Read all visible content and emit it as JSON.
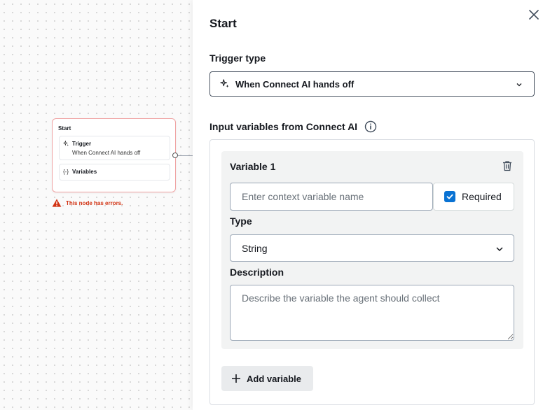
{
  "canvas": {
    "node": {
      "title": "Start",
      "trigger_label": "Trigger",
      "trigger_value": "When Connect AI hands off",
      "variables_label": "Variables",
      "trigger_icon": "sparkle-icon",
      "variables_icon": "braces-icon"
    },
    "error_text": "This node has errors.",
    "error_color": "#d13212"
  },
  "panel": {
    "title": "Start",
    "trigger_type_label": "Trigger type",
    "trigger_type_value": "When Connect AI hands off",
    "inputs_label": "Input variables from Connect AI",
    "variables": [
      {
        "title": "Variable 1",
        "name_placeholder": "Enter context variable name",
        "name_value": "",
        "required_label": "Required",
        "required_checked": true,
        "type_label": "Type",
        "type_value": "String",
        "description_label": "Description",
        "description_placeholder": "Describe the variable the agent should collect",
        "description_value": ""
      }
    ],
    "add_variable_label": "Add variable",
    "accent_color": "#0972d3"
  }
}
